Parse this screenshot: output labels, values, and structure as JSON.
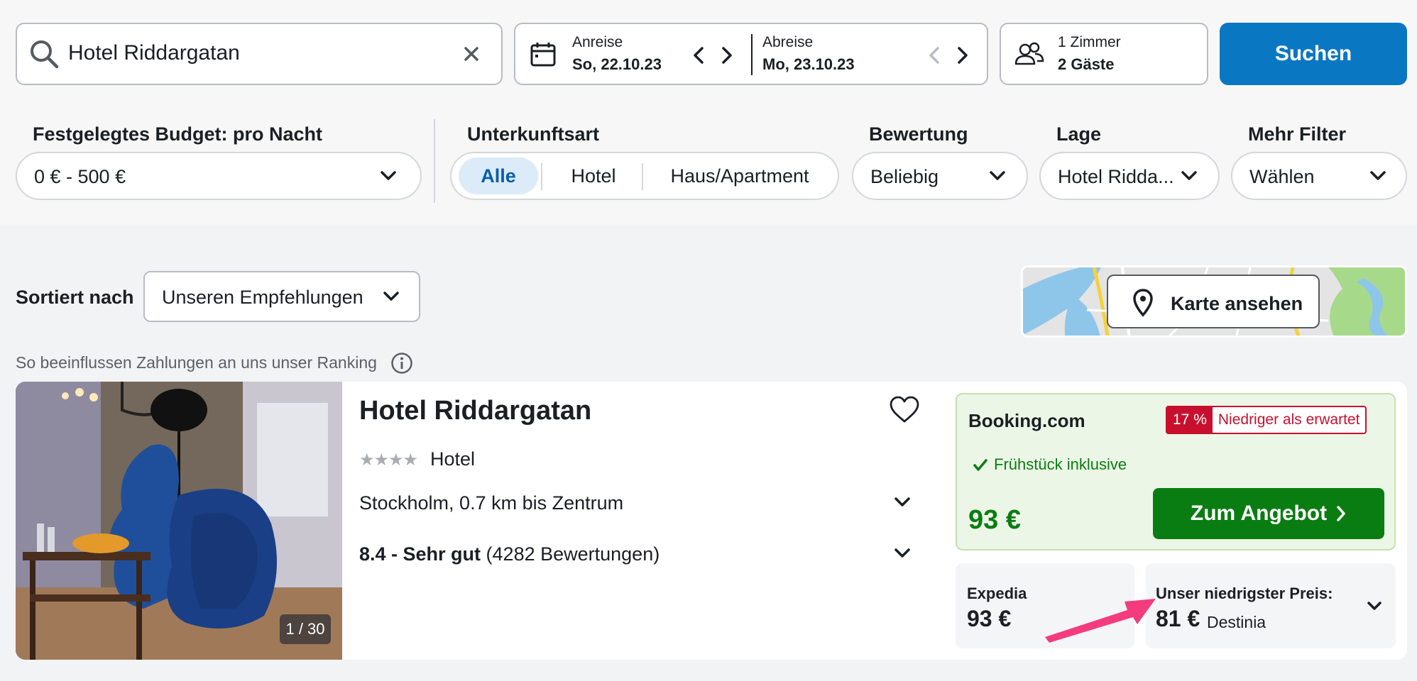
{
  "search": {
    "value": "Hotel Riddargatan",
    "checkin_label": "Anreise",
    "checkin_value": "So, 22.10.23",
    "checkout_label": "Abreise",
    "checkout_value": "Mo, 23.10.23",
    "rooms_label": "1 Zimmer",
    "guests_label": "2 Gäste",
    "search_button": "Suchen"
  },
  "filters": {
    "budget_label": "Festgelegtes Budget: pro Nacht",
    "budget_value": "0 € - 500 €",
    "type_label": "Unterkunftsart",
    "type_options": [
      "Alle",
      "Hotel",
      "Haus/Apartment"
    ],
    "type_selected": "Alle",
    "rating_label": "Bewertung",
    "rating_value": "Beliebig",
    "location_label": "Lage",
    "location_value": "Hotel Ridda...",
    "more_label": "Mehr Filter",
    "more_value": "Wählen"
  },
  "sort": {
    "label": "Sortiert nach",
    "value": "Unseren Empfehlungen"
  },
  "map_button": "Karte ansehen",
  "ranking_note": "So beeinflussen Zahlungen an uns unser Ranking",
  "hotel": {
    "name": "Hotel Riddargatan",
    "stars": 4,
    "type": "Hotel",
    "location": "Stockholm, 0.7 km bis Zentrum",
    "rating_score": "8.4 - Sehr gut",
    "rating_count": "(4282 Bewertungen)",
    "image_counter": "1 / 30",
    "featured_offer": {
      "provider": "Booking.com",
      "discount_percent": "17 %",
      "discount_text": "Niedriger als erwartet",
      "perk": "Frühstück inklusive",
      "price": "93 €",
      "cta": "Zum Angebot"
    },
    "other_offer": {
      "provider": "Expedia",
      "price": "93 €"
    },
    "lowest_offer": {
      "label": "Unser niedrigster Preis:",
      "price": "81 €",
      "provider": "Destinia"
    }
  },
  "colors": {
    "primary_blue": "#0a77c2",
    "deal_green": "#0a7d12",
    "deal_bg": "#ecf6e6",
    "badge_red": "#c8102e",
    "arrow_pink": "#f33b7e"
  }
}
